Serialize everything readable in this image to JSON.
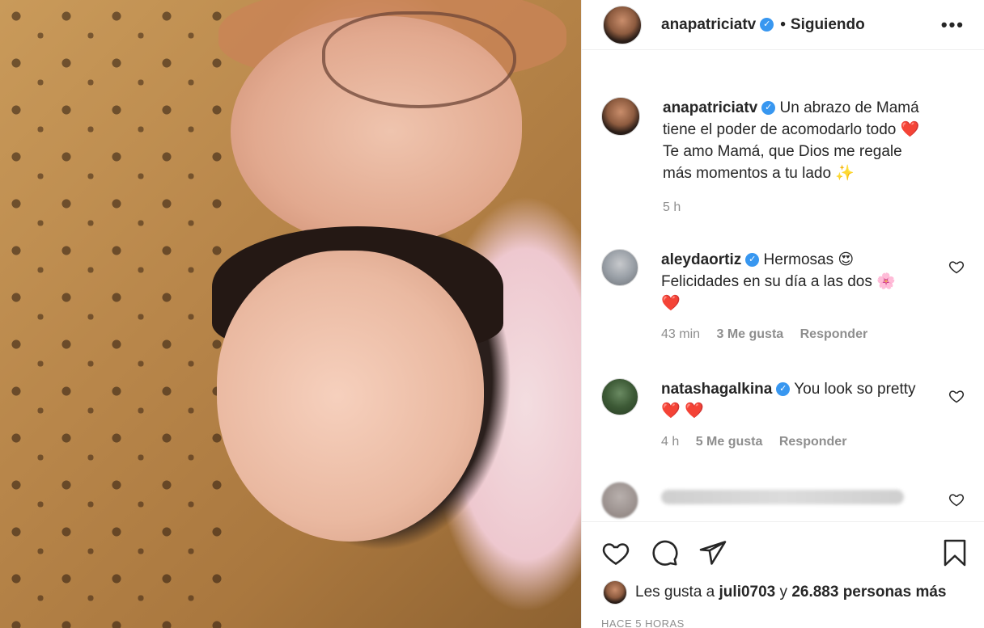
{
  "post": {
    "username": "anapatriciatv",
    "follow_status": "Siguiendo",
    "dot": "•",
    "more": "•••"
  },
  "caption": {
    "username": "anapatriciatv",
    "text_1": "Un abrazo de Mamá tiene el poder de acomodarlo todo",
    "heart": "❤️",
    "text_2": "Te amo Mamá, que Dios me regale más momentos a tu lado",
    "sparkles": "✨",
    "time": "5 h"
  },
  "comments": [
    {
      "username": "aleydaortiz",
      "text_1": "Hermosas",
      "emoji_1": "😍",
      "text_2": "Felicidades en su día a las dos",
      "emoji_2": "🌸",
      "emoji_3": "❤️",
      "time": "43 min",
      "likes": "3 Me gusta",
      "reply": "Responder"
    },
    {
      "username": "natashagalkina",
      "text_1": "You look so pretty",
      "emoji_1": "❤️",
      "emoji_2": "❤️",
      "time": "4 h",
      "likes": "5 Me gusta",
      "reply": "Responder"
    }
  ],
  "likes_line": {
    "prefix": "Les gusta a",
    "user": "juli0703",
    "middle": "y",
    "count": "26.883 personas más"
  },
  "timestamp": "HACE 5 HORAS",
  "icons": [
    "heart-icon",
    "comment-icon",
    "share-icon",
    "bookmark-icon",
    "verified-icon",
    "more-options-icon"
  ],
  "colors": {
    "verified": "#3897f0",
    "text": "#262626",
    "muted": "#8e8e8e",
    "border": "#efefef"
  }
}
